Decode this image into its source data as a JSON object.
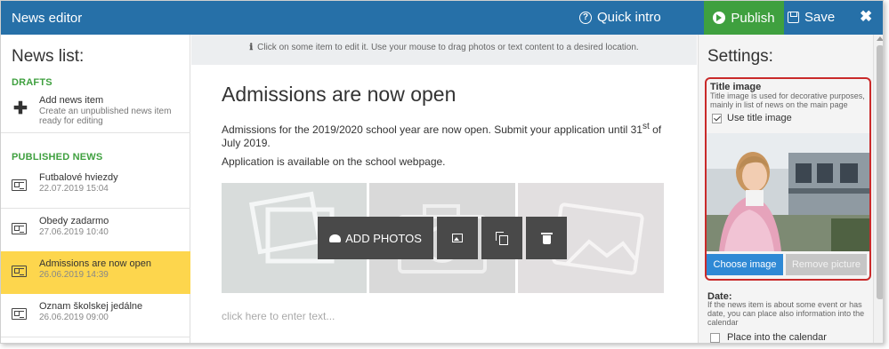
{
  "header": {
    "title": "News editor",
    "quick_intro": "Quick intro",
    "publish": "Publish",
    "save": "Save",
    "close": "✖",
    "colors": {
      "bar": "#2670a8",
      "publish": "#3fa03f"
    }
  },
  "sidebar": {
    "heading": "News list:",
    "drafts_label": "DRAFTS",
    "add_item": {
      "title": "Add news item",
      "subtitle": "Create an unpublished news item ready for editing"
    },
    "published_label": "PUBLISHED NEWS",
    "items": [
      {
        "title": "Futbalové hviezdy",
        "date": "22.07.2019 15:04",
        "active": false
      },
      {
        "title": "Obedy zadarmo",
        "date": "27.06.2019 10:40",
        "active": false
      },
      {
        "title": "Admissions are now open",
        "date": "26.06.2019 14:39",
        "active": true
      },
      {
        "title": "Oznam školskej jedálne",
        "date": "26.06.2019 09:00",
        "active": false
      }
    ]
  },
  "editor": {
    "hint": "Click on some item to edit it. Use your mouse to drag photos or text content to a desired location.",
    "headline": "Admissions are now open",
    "paragraph1_pre": "Admissions for the 2019/2020 school year are now open. Submit your application until 31",
    "paragraph1_sup": "st",
    "paragraph1_post": " of July 2019.",
    "paragraph2": "Application is available on the school webpage.",
    "add_photos": "ADD PHOTOS",
    "enter_text_placeholder": "click here to enter text..."
  },
  "settings": {
    "heading": "Settings:",
    "title_image": {
      "title": "Title image",
      "subtitle": "Title image is used for decorative purposes, mainly in list of news on the main page",
      "use_label": "Use title image",
      "use_checked": true,
      "choose_label": "Choose image",
      "remove_label": "Remove picture"
    },
    "date": {
      "title": "Date:",
      "subtitle": "If the news item is about some event or has date, you can place also information into the calendar",
      "calendar_label": "Place into the calendar",
      "calendar_checked": false
    },
    "highlight_color": "#c92a2a"
  }
}
